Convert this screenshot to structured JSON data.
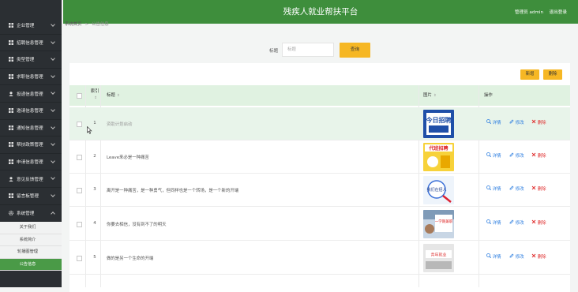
{
  "header": {
    "title": "残疾人就业帮扶平台",
    "user": "管理员 admin",
    "logout": "退出登录"
  },
  "breadcrumb": {
    "home": "系统首页",
    "sep": ">",
    "current": "公告信息"
  },
  "sidebar": {
    "items": [
      {
        "label": "企业管理",
        "icon": "grid-icon"
      },
      {
        "label": "招聘信息管理",
        "icon": "grid-icon"
      },
      {
        "label": "类型管理",
        "icon": "grid-icon"
      },
      {
        "label": "求职信息管理",
        "icon": "grid-icon"
      },
      {
        "label": "投递信息管理",
        "icon": "user-icon"
      },
      {
        "label": "邀请信息管理",
        "icon": "grid-icon"
      },
      {
        "label": "通知信息管理",
        "icon": "grid-icon"
      },
      {
        "label": "帮扶政策管理",
        "icon": "grid-icon"
      },
      {
        "label": "申请信息管理",
        "icon": "grid-icon"
      },
      {
        "label": "意见反馈管理",
        "icon": "user-icon"
      },
      {
        "label": "留言板管理",
        "icon": "grid-icon"
      },
      {
        "label": "系统管理",
        "icon": "gear-icon"
      }
    ],
    "subitems": [
      {
        "label": "关于我们"
      },
      {
        "label": "系统简介"
      },
      {
        "label": "轮播图管理"
      },
      {
        "label": "公告信息"
      }
    ]
  },
  "search": {
    "label": "标题",
    "placeholder": "标题",
    "button": "查询"
  },
  "toolbar": {
    "add": "新增",
    "delete": "删除"
  },
  "table": {
    "columns": {
      "index": "索引",
      "title": "标题",
      "image": "图片",
      "actions": "操作"
    },
    "sort_glyph": "⇕",
    "actions": {
      "detail": "详情",
      "edit": "修改",
      "delete": "删除"
    },
    "rows": [
      {
        "index": "1",
        "title": "资助计划启动",
        "image_text": "今日招聘",
        "image_theme": "blue"
      },
      {
        "index": "2",
        "title": "Leave来必是一种痛苦",
        "image_text": "代班招聘",
        "image_theme": "yellow"
      },
      {
        "index": "3",
        "title": "离开是一种痛苦，是一种勇气，但同样也是一个转场，是一个新的开端",
        "image_text": "我们在招人",
        "image_theme": "blue-line"
      },
      {
        "index": "4",
        "title": "你要去相信，没有到不了的明天",
        "image_text": "一学期兼职 行业",
        "image_theme": "photo"
      },
      {
        "index": "5",
        "title": "做的是另一个生命的开端",
        "image_text": "青年就业",
        "image_theme": "grey"
      }
    ]
  },
  "colors": {
    "sidebar": "#2b2f33",
    "header": "#3e8e3c",
    "accent": "#f6b724",
    "active_sub": "#4a9a47",
    "table_head": "#e0f2e1"
  }
}
